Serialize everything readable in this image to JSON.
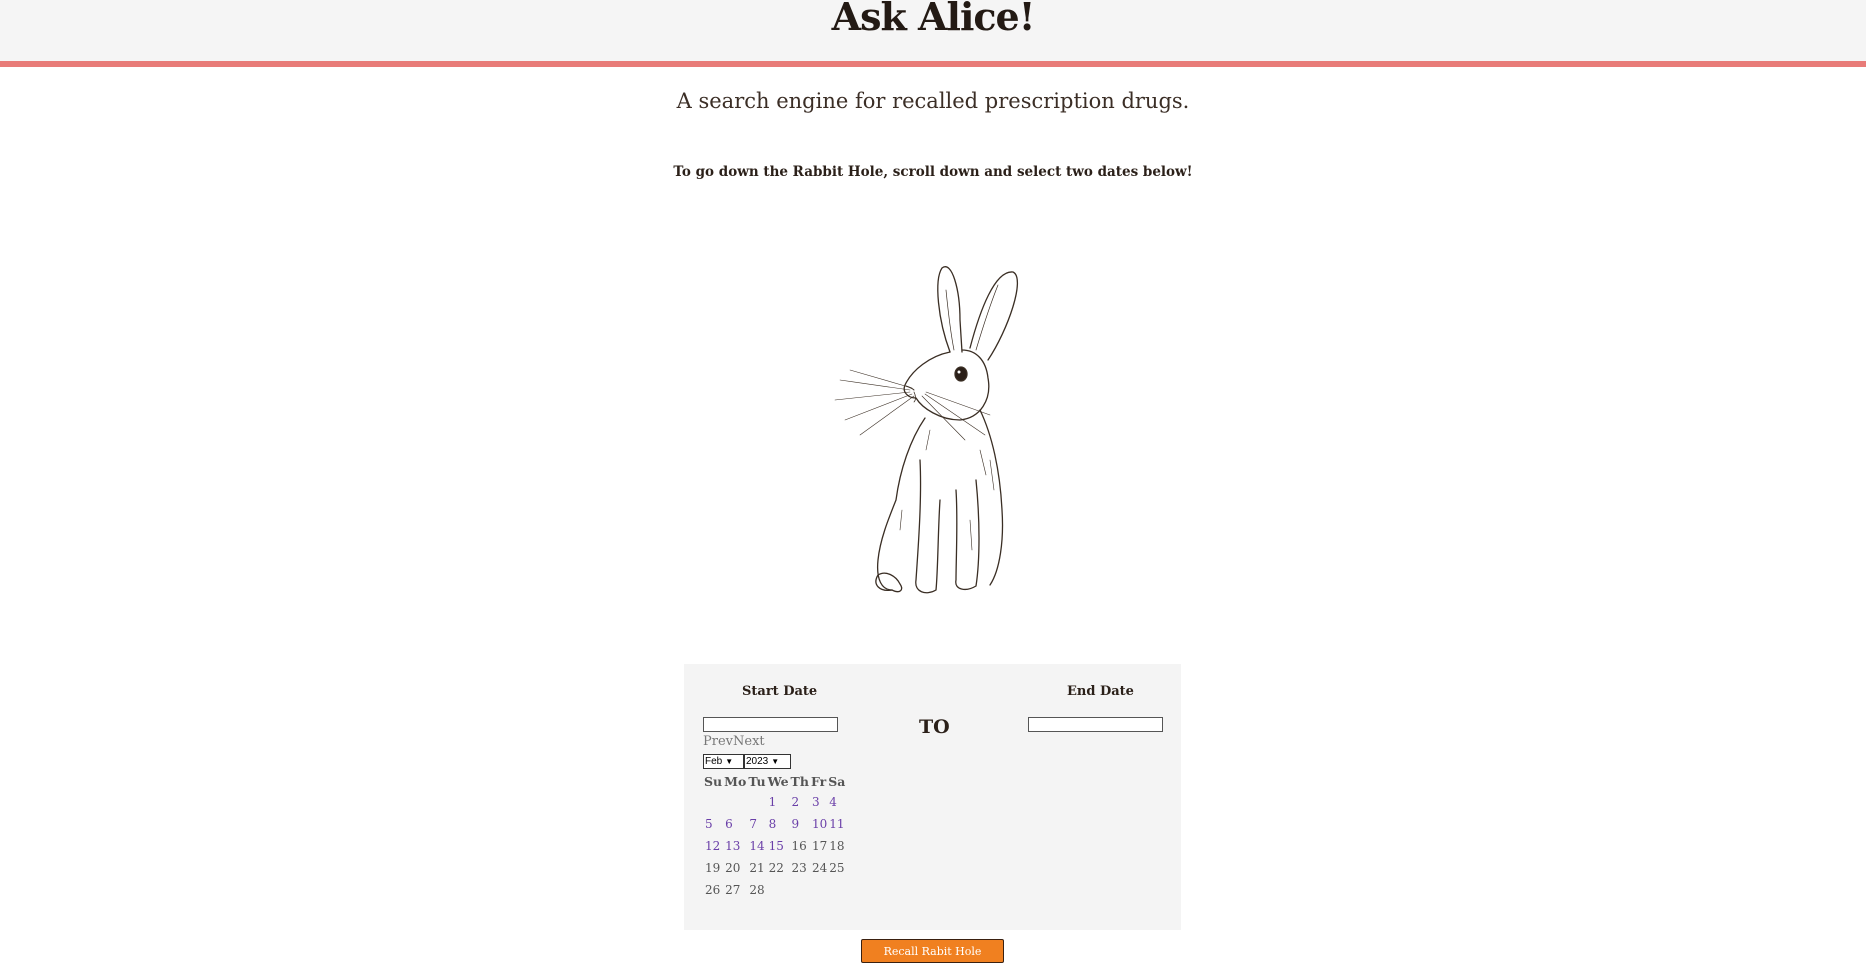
{
  "header": {
    "title": "Ask Alice!"
  },
  "subtitle": "A search engine for recalled prescription drugs.",
  "instruction": "To go down the Rabbit Hole, scroll down and select two dates below!",
  "colors": {
    "accent_line": "#e87b78",
    "button": "#f08020",
    "header_bg": "#f5f5f5",
    "panel_bg": "#f4f4f4"
  },
  "date_panel": {
    "start_label": "Start Date",
    "end_label": "End Date",
    "separator": "TO",
    "start_value": "",
    "end_value": "",
    "calendar": {
      "prev": "Prev",
      "next": "Next",
      "month": "Feb",
      "year": "2023",
      "weekdays": [
        "Su",
        "Mo",
        "Tu",
        "We",
        "Th",
        "Fr",
        "Sa"
      ],
      "weeks": [
        [
          "",
          "",
          "",
          "1",
          "2",
          "3",
          "4"
        ],
        [
          "5",
          "6",
          "7",
          "8",
          "9",
          "10",
          "11"
        ],
        [
          "12",
          "13",
          "14",
          "15",
          "16",
          "17",
          "18"
        ],
        [
          "19",
          "20",
          "21",
          "22",
          "23",
          "24",
          "25"
        ],
        [
          "26",
          "27",
          "28",
          "",
          "",
          "",
          ""
        ]
      ]
    }
  },
  "button": {
    "label": "Recall Rabit Hole"
  }
}
